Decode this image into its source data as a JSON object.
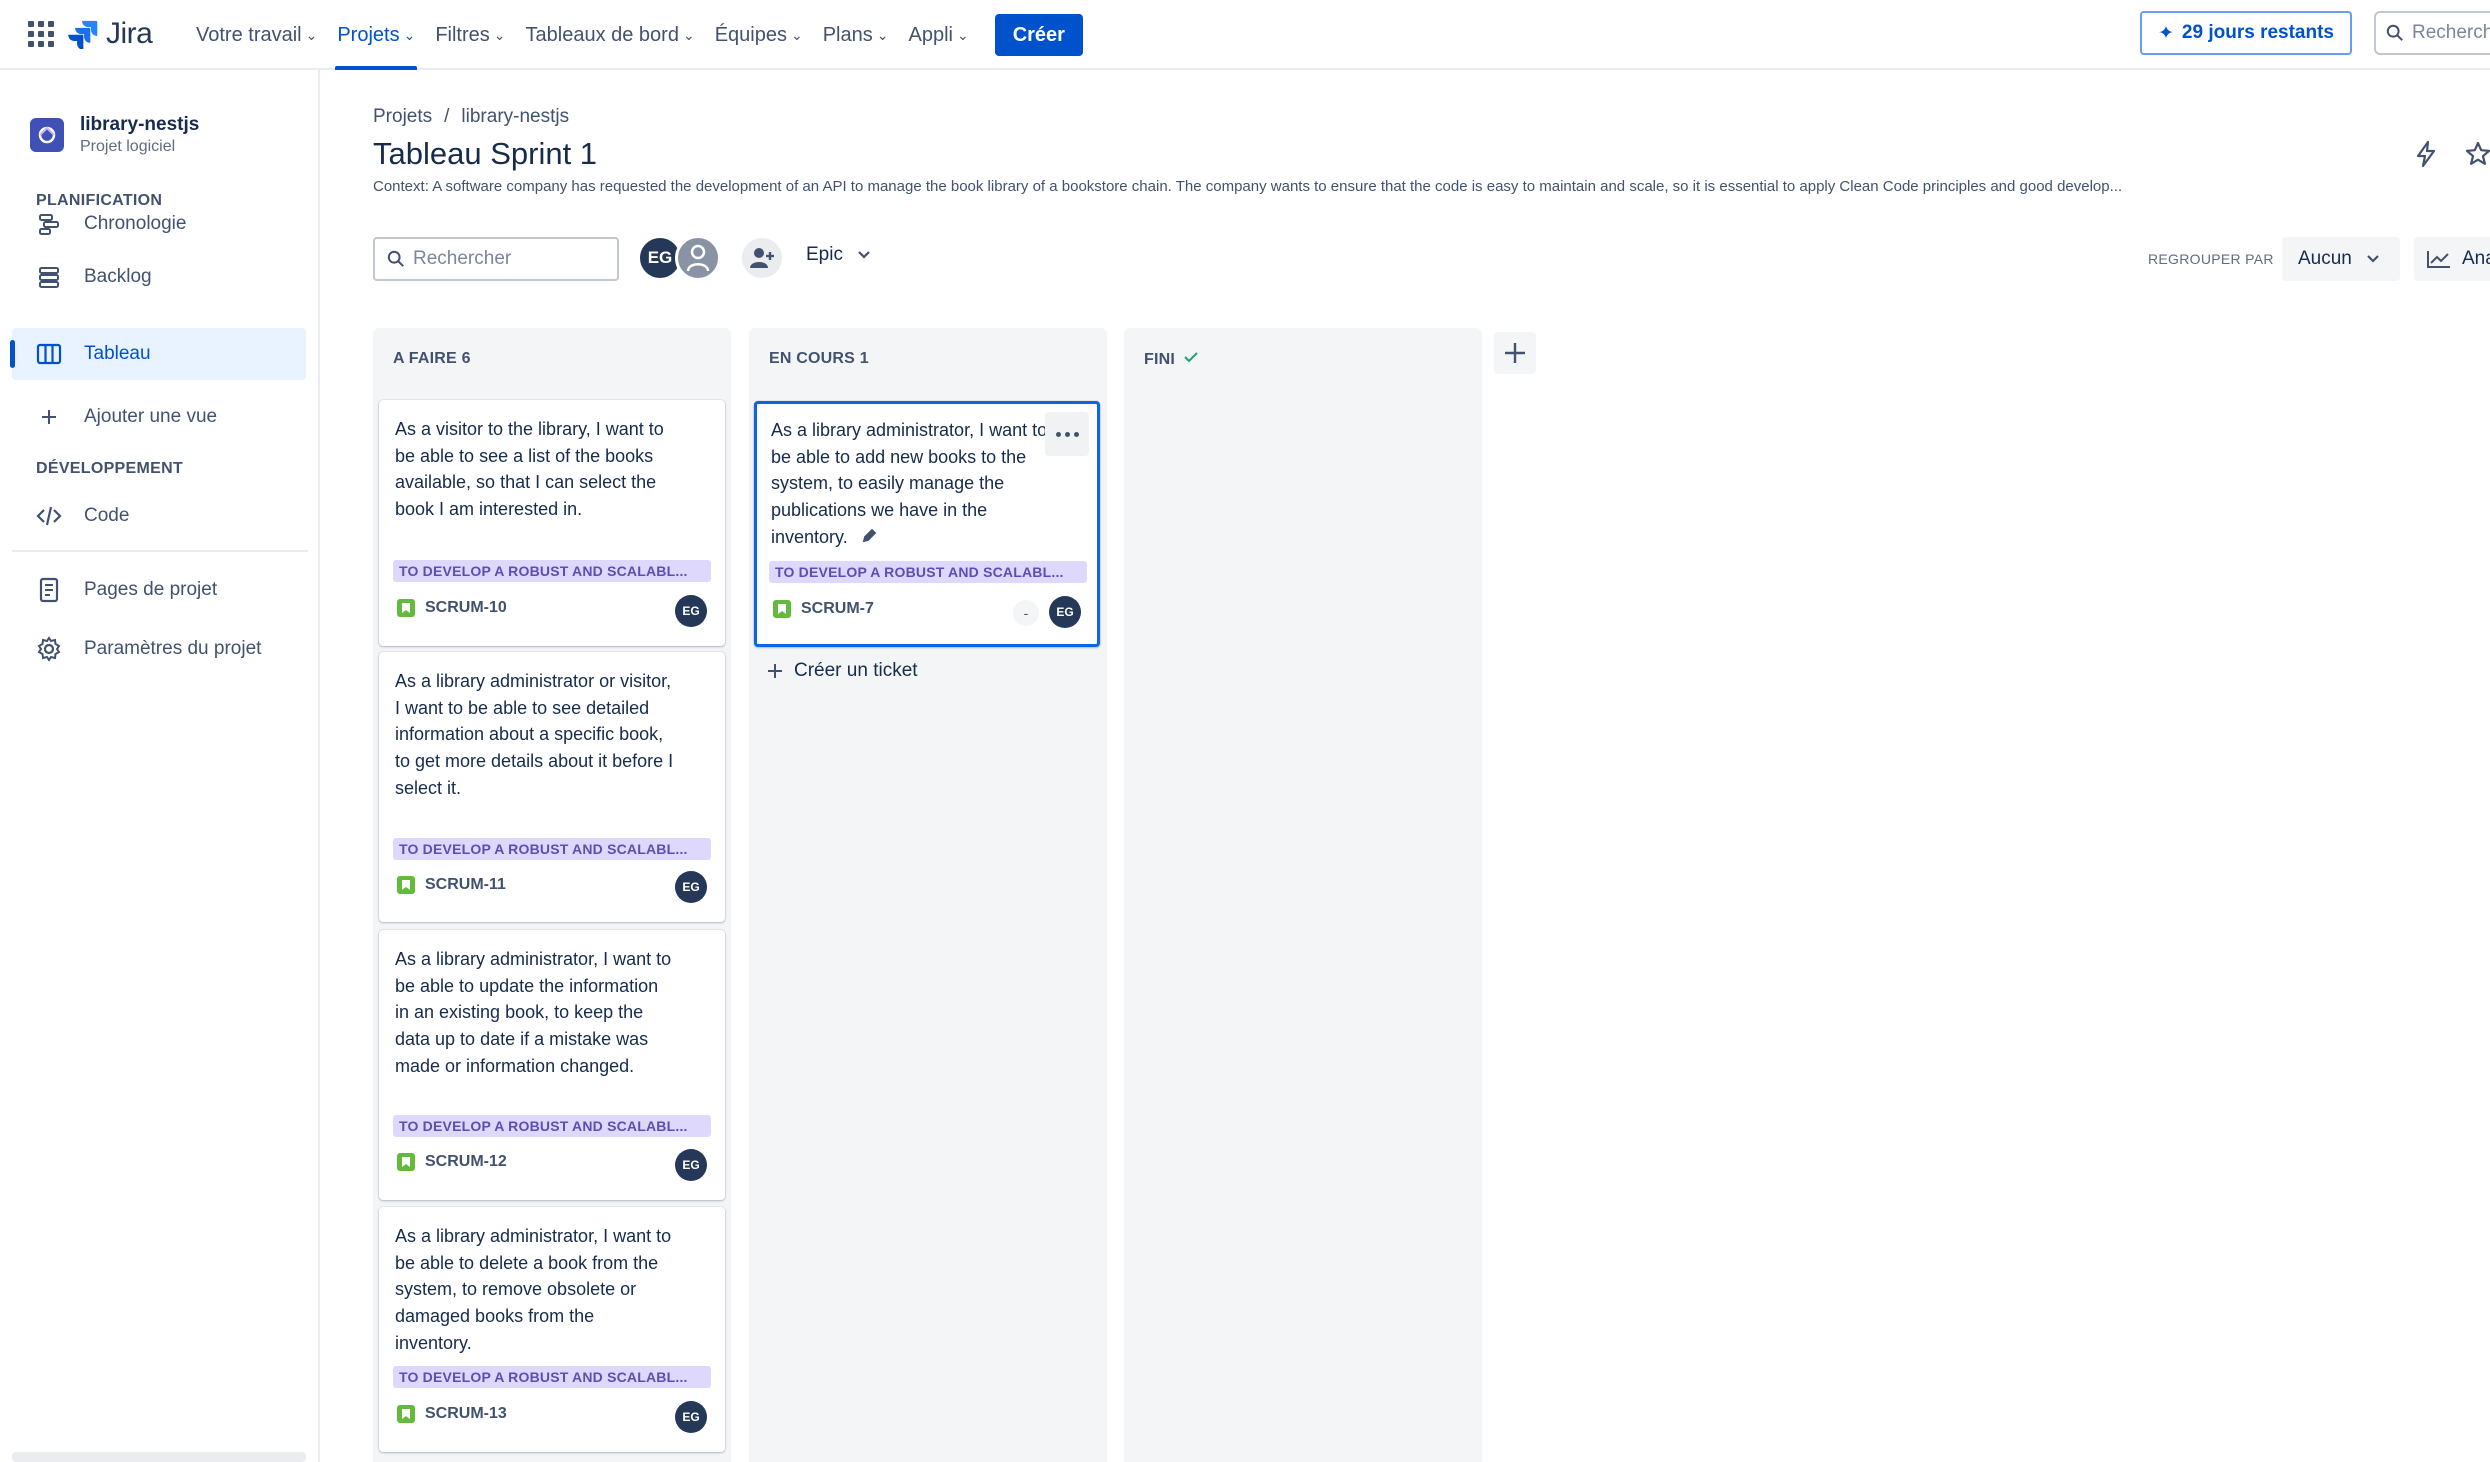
{
  "topnav": {
    "logo_text": "Jira",
    "items": [
      {
        "label": "Votre travail"
      },
      {
        "label": "Projets"
      },
      {
        "label": "Filtres"
      },
      {
        "label": "Tableaux de bord"
      },
      {
        "label": "Équipes"
      },
      {
        "label": "Plans"
      },
      {
        "label": "Appli"
      }
    ],
    "create_label": "Créer",
    "trial_label": "29 jours restants",
    "search_placeholder": "Recherch"
  },
  "sidebar": {
    "project_name": "library-nestjs",
    "project_type": "Projet logiciel",
    "section_planning": "PLANIFICATION",
    "planning_items": [
      {
        "label": "Chronologie",
        "icon": "timeline-icon"
      },
      {
        "label": "Backlog",
        "icon": "backlog-icon"
      },
      {
        "label": "Tableau",
        "icon": "board-icon"
      }
    ],
    "add_view_label": "Ajouter une vue",
    "section_dev": "DÉVELOPPEMENT",
    "code_label": "Code",
    "project_pages_label": "Pages de projet",
    "project_settings_label": "Paramètres du projet"
  },
  "header": {
    "breadcrumb": [
      "Projets",
      "/",
      "library-nestjs"
    ],
    "title": "Tableau Sprint 1",
    "context": "Context: A software company has requested the development of an API to manage the book library of a bookstore chain. The company wants to ensure that the code is easy to maintain and scale, so it is essential to apply Clean Code principles and good develop..."
  },
  "toolbar": {
    "search_placeholder": "Rechercher",
    "avatar_initials": "EG",
    "epic_filter_label": "Epic",
    "group_by_label": "REGROUPER PAR",
    "group_by_value": "Aucun",
    "insights_label": "Ana"
  },
  "columns": [
    {
      "title": "A FAIRE 6"
    },
    {
      "title": "EN COURS 1"
    },
    {
      "title": "FINI"
    }
  ],
  "cards": [
    {
      "text": "As a visitor to the library, I want to be able to see a list of the books available, so that I can select the book I am interested in.",
      "epic": "TO DEVELOP A ROBUST AND SCALABL...",
      "key": "SCRUM-10",
      "assignee": "EG"
    },
    {
      "text": "As a library administrator or visitor, I want to be able to see detailed information about a specific book, to get more details about it before I select it.",
      "epic": "TO DEVELOP A ROBUST AND SCALABL...",
      "key": "SCRUM-11",
      "assignee": "EG"
    },
    {
      "text": "As a library administrator, I want to be able to update the information in an existing book, to keep the data up to date if a mistake was made or information changed.",
      "epic": "TO DEVELOP A ROBUST AND SCALABL...",
      "key": "SCRUM-12",
      "assignee": "EG"
    },
    {
      "text": "As a library administrator, I want to be able to delete a book from the system, to remove obsolete or damaged books from the inventory.",
      "epic": "TO DEVELOP A ROBUST AND SCALABL...",
      "key": "SCRUM-13",
      "assignee": "EG"
    },
    {
      "text": "As a library administrator, I want to be able to add new books to the system, to easily manage the publications we have in the inventory.",
      "epic": "TO DEVELOP A ROBUST AND SCALABL...",
      "key": "SCRUM-7",
      "assignee": "EG",
      "estimate": "-"
    }
  ],
  "create_ticket_label": "Créer un ticket",
  "colors": {
    "accent": "#0052cc",
    "epic_bg": "#dfd8fd",
    "epic_text": "#5e4db2",
    "story_icon": "#63ba3c"
  }
}
